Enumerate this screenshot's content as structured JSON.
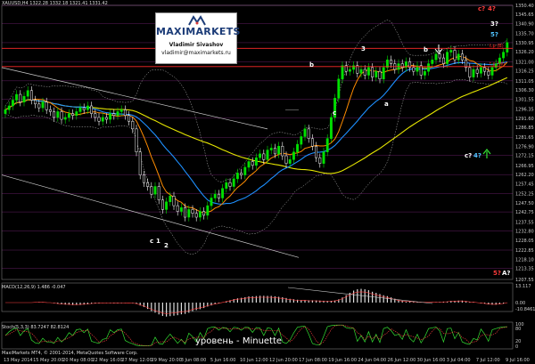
{
  "window": {
    "header": "XAUUSD,H4  1322.28 1332.18 1321.41 1331.42",
    "footer": "MaxiMarkets MT4, © 2001-2014, MetaQuotes Software Corp.",
    "caption": "уровень - Minuette"
  },
  "logo": {
    "brand": "MAXIMARKETS",
    "name": "Vladimir Sivashov",
    "email": "vladimir@maximarkets.ru"
  },
  "indicators": {
    "macd_label": "MACD(12,26,9) 1.486 -0.047",
    "stoch_label": "Stoch(5,3,3) 83.7247 82.8124"
  },
  "chart_data": {
    "type": "candlestick",
    "symbol": "XAUUSD",
    "timeframe": "H4",
    "ylim": [
      1207.55,
      1350.4
    ],
    "price_ticks": [
      1350.4,
      1345.65,
      1340.9,
      1335.7,
      1330.95,
      1326.2,
      1321.0,
      1316.25,
      1311.05,
      1306.3,
      1301.55,
      1296.35,
      1291.6,
      1286.85,
      1281.65,
      1276.9,
      1272.15,
      1266.95,
      1262.2,
      1257.45,
      1252.25,
      1247.5,
      1242.75,
      1237.55,
      1232.8,
      1228.05,
      1222.85,
      1218.1,
      1213.35,
      1207.55
    ],
    "time_ticks": [
      "13 May 2014",
      "15 May 20:00",
      "20 May 08:00",
      "22 May 16:00",
      "27 May 12:00",
      "29 May 20:00",
      "3 Jun 08:00",
      "5 Jun 16:00",
      "10 Jun 12:00",
      "12 Jun 20:00",
      "17 Jun 08:00",
      "19 Jun 16:00",
      "24 Jun 04:00",
      "26 Jun 12:00",
      "30 Jun 16:00",
      "3 Jul 04:00",
      "7 Jul 12:00",
      "9 Jul 16:00"
    ],
    "close": [
      1296,
      1298,
      1301,
      1304,
      1300,
      1303,
      1306,
      1301,
      1299,
      1297,
      1300,
      1296,
      1295,
      1292,
      1295,
      1291,
      1292,
      1294,
      1293,
      1295,
      1297,
      1296,
      1298,
      1294,
      1292,
      1290,
      1292,
      1291,
      1294,
      1293,
      1295,
      1296,
      1293,
      1290,
      1286,
      1274,
      1262,
      1258,
      1256,
      1252,
      1256,
      1249,
      1244,
      1248,
      1251,
      1246,
      1243,
      1245,
      1240,
      1244,
      1242,
      1240,
      1243,
      1241,
      1246,
      1250,
      1252,
      1250,
      1255,
      1258,
      1256,
      1260,
      1263,
      1262,
      1266,
      1269,
      1267,
      1271,
      1273,
      1270,
      1275,
      1276,
      1273,
      1277,
      1272,
      1268,
      1270,
      1274,
      1278,
      1282,
      1286,
      1281,
      1277,
      1271,
      1268,
      1274,
      1281,
      1292,
      1302,
      1312,
      1319,
      1316,
      1317,
      1319,
      1315,
      1317,
      1314,
      1318,
      1313,
      1316,
      1312,
      1318,
      1322,
      1320,
      1317,
      1320,
      1318,
      1321,
      1318,
      1316,
      1319,
      1314,
      1316,
      1320,
      1322,
      1325,
      1323,
      1320,
      1326,
      1327,
      1322,
      1325,
      1322,
      1318,
      1313,
      1317,
      1315,
      1318,
      1316,
      1314,
      1318,
      1320,
      1323,
      1326,
      1331
    ],
    "annotations": [
      {
        "text": "c?",
        "color": "#ff3b3b"
      },
      {
        "text": "4?",
        "color": "#ff3b3b"
      },
      {
        "text": "3?",
        "color": "#ffffff"
      },
      {
        "text": "5?",
        "color": "#4fc3ff"
      },
      {
        "text": "c?",
        "color": "#ffffff"
      },
      {
        "text": "4?",
        "color": "#4fc3ff"
      },
      {
        "text": "5?",
        "color": "#ff3b3b"
      },
      {
        "text": "A?",
        "color": "#ffffff"
      },
      {
        "text": "b",
        "color": "#ffffff"
      },
      {
        "text": "c",
        "color": "#ffffff"
      },
      {
        "text": "a",
        "color": "#ffffff"
      },
      {
        "text": "b",
        "color": "#ffffff"
      },
      {
        "text": "2",
        "color": "#ffffff"
      },
      {
        "text": "1",
        "color": "#ffffff"
      },
      {
        "text": "c",
        "color": "#ffffff"
      },
      {
        "text": "3",
        "color": "#ffffff"
      }
    ],
    "levels": [
      {
        "label": "t.p (B)",
        "price": 1328.0,
        "color": "#ff2a2a"
      },
      {
        "label": "t.p (W)",
        "price": 1318.5,
        "color": "#ff2a2a"
      }
    ],
    "colors": {
      "bull": "#00e000",
      "bear": "#ffffff",
      "ma_fast": "#ff8c00",
      "ma_mid": "#1e90ff",
      "ma_slow": "#e6e600",
      "bands": "#bbbbbb",
      "level": "#ff2a2a",
      "grid": "#dd44dd"
    }
  }
}
